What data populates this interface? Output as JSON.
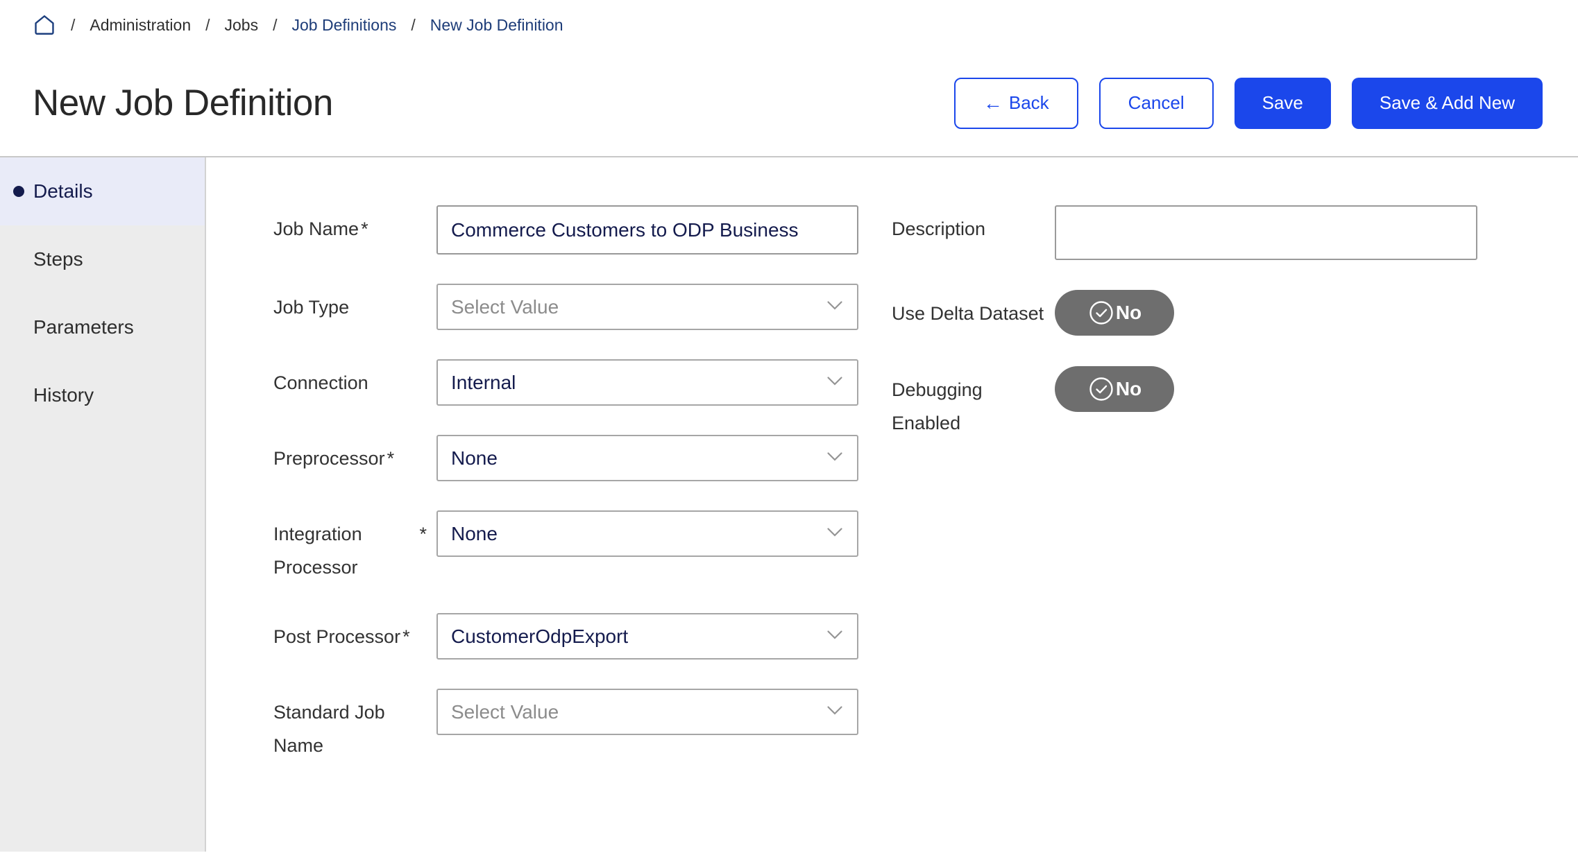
{
  "breadcrumb": {
    "separator": "/",
    "items": [
      {
        "label": "Administration",
        "type": "text"
      },
      {
        "label": "Jobs",
        "type": "text"
      },
      {
        "label": "Job Definitions",
        "type": "link"
      },
      {
        "label": "New Job Definition",
        "type": "link"
      }
    ]
  },
  "header": {
    "title": "New Job Definition",
    "actions": {
      "back": "Back",
      "cancel": "Cancel",
      "save": "Save",
      "save_add_new": "Save & Add New"
    }
  },
  "icons": {
    "breadcrumb_home": "home-icon",
    "back_arrow": "←",
    "select_chevron": "chevron-down-icon",
    "toggle_status": "check-circle-icon"
  },
  "sidebar": {
    "items": [
      {
        "label": "Details",
        "active": true
      },
      {
        "label": "Steps",
        "active": false
      },
      {
        "label": "Parameters",
        "active": false
      },
      {
        "label": "History",
        "active": false
      }
    ]
  },
  "form": {
    "required_marker": "*",
    "left": [
      {
        "label": "Job Name",
        "required": true,
        "type": "text",
        "value": "Commerce Customers to ODP Business"
      },
      {
        "label": "Job Type",
        "required": false,
        "type": "select",
        "placeholder": "Select Value"
      },
      {
        "label": "Connection",
        "required": false,
        "type": "select",
        "value": "Internal"
      },
      {
        "label": "Preprocessor",
        "required": true,
        "type": "select",
        "value": "None"
      },
      {
        "label": "Integration Processor",
        "required": true,
        "type": "select",
        "value": "None"
      },
      {
        "label": "Post Processor",
        "required": true,
        "type": "select",
        "value": "CustomerOdpExport"
      },
      {
        "label": "Standard Job Name",
        "required": false,
        "type": "select",
        "placeholder": "Select Value"
      }
    ],
    "right": [
      {
        "label": "Description",
        "type": "textarea",
        "value": ""
      },
      {
        "label": "Use Delta Dataset",
        "type": "toggle",
        "value": "No"
      },
      {
        "label": "Debugging Enabled",
        "type": "toggle",
        "value": "No"
      }
    ]
  },
  "colors": {
    "primary_blue": "#1b47eb",
    "navy_text": "#141b4d",
    "breadcrumb_link": "#1d3c78",
    "toggle_gray": "#6e6e6e",
    "sidebar_bg": "#ececec",
    "sidebar_active_bg": "#e9ebf8",
    "input_border": "#a6a6a6"
  }
}
